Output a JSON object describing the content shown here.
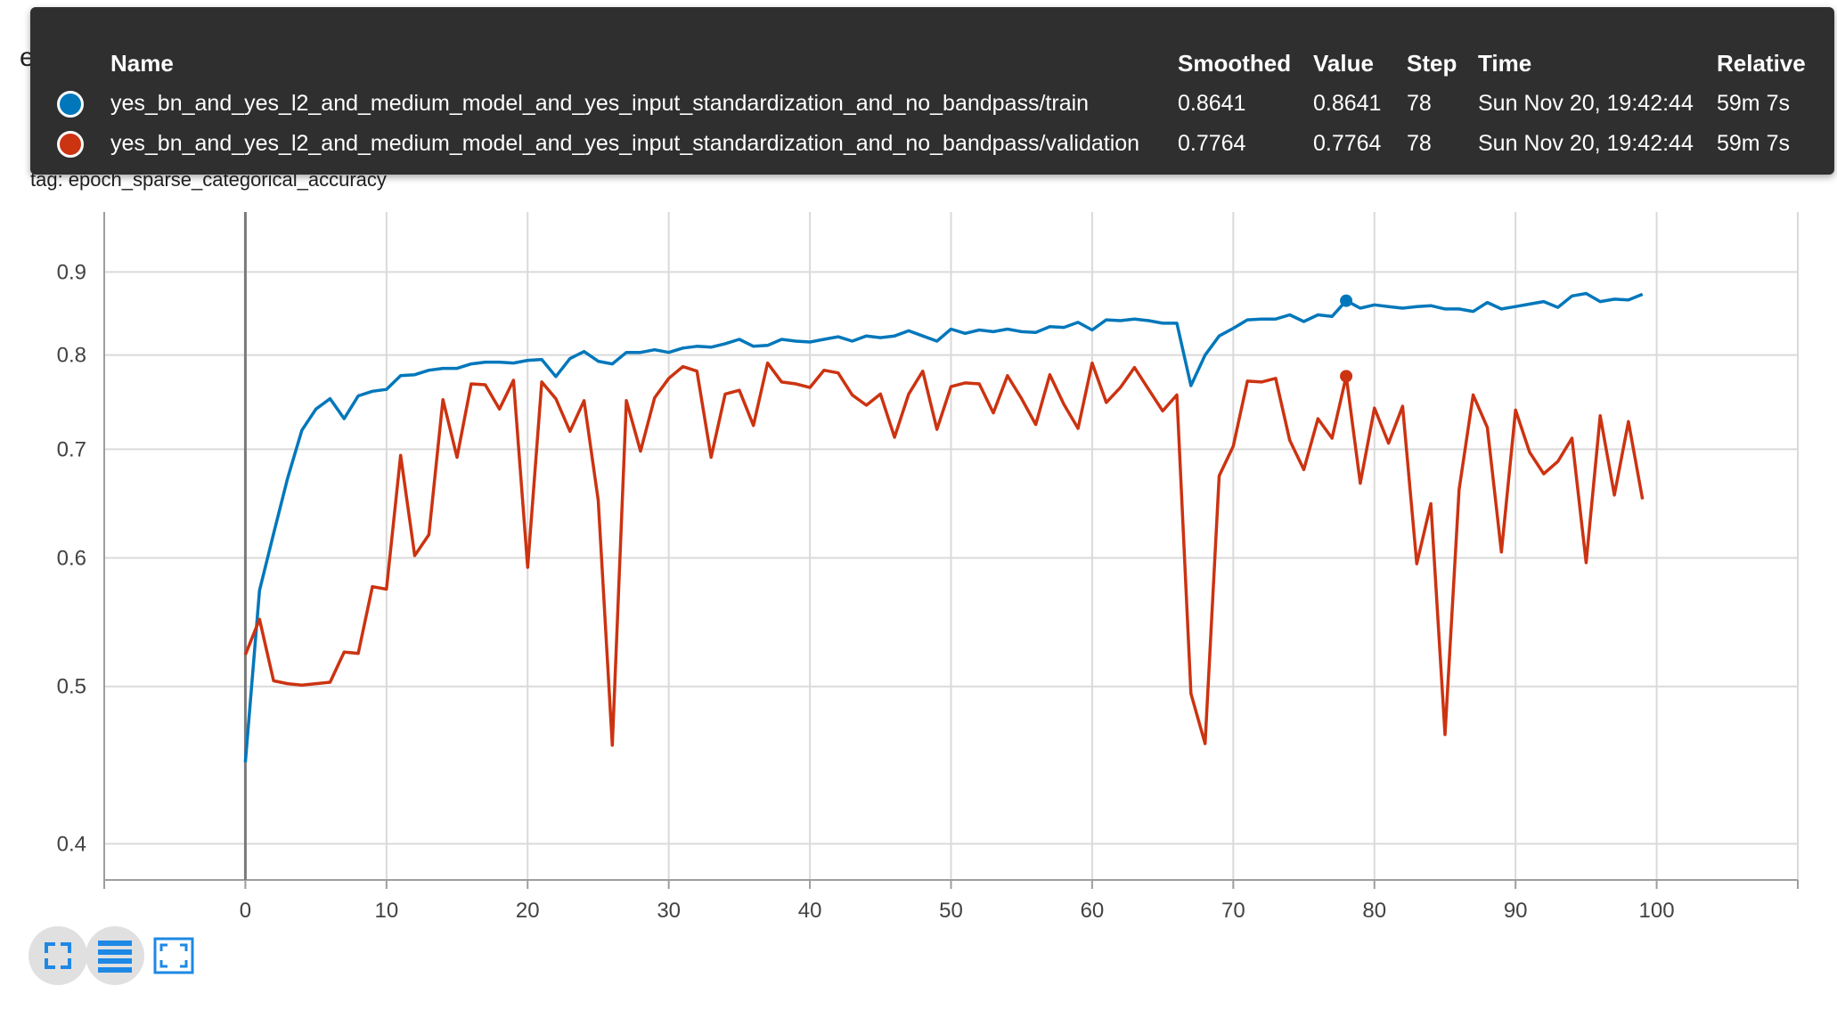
{
  "card": {
    "title": "epoch_sparse_categorical_accuracy",
    "subtitle": "epoch_sparse_categorical_accuracy",
    "tag": "tag: epoch_sparse_categorical_accuracy"
  },
  "tooltip": {
    "headers": {
      "name": "Name",
      "smoothed": "Smoothed",
      "value": "Value",
      "step": "Step",
      "time": "Time",
      "relative": "Relative"
    },
    "rows": [
      {
        "name": "yes_bn_and_yes_l2_and_medium_model_and_yes_input_standardization_and_no_bandpass/train",
        "smoothed": "0.8641",
        "value": "0.8641",
        "step": "78",
        "time": "Sun Nov 20, 19:42:44",
        "relative": "59m 7s",
        "color": "#0077bb"
      },
      {
        "name": "yes_bn_and_yes_l2_and_medium_model_and_yes_input_standardization_and_no_bandpass/validation",
        "smoothed": "0.7764",
        "value": "0.7764",
        "step": "78",
        "time": "Sun Nov 20, 19:42:44",
        "relative": "59m 7s",
        "color": "#cc3311"
      }
    ]
  },
  "toolbar": {
    "fullscreen_icon": "fullscreen-icon",
    "log_scale_icon": "log-scale-icon",
    "fit_domain_icon": "fit-domain-icon"
  },
  "chart_data": {
    "type": "line",
    "y_scale": "log",
    "xlim": [
      -10,
      110
    ],
    "ylim": [
      0.38,
      0.98
    ],
    "x_ticks": [
      0,
      10,
      20,
      30,
      40,
      50,
      60,
      70,
      80,
      90,
      100
    ],
    "y_ticks": [
      0.4,
      0.5,
      0.6,
      0.7,
      0.8,
      0.9
    ],
    "y_tick_labels": [
      "0.4",
      "0.5",
      "0.6",
      "0.7",
      "0.8",
      "0.9"
    ],
    "grid": true,
    "highlight_step": 78,
    "series": [
      {
        "color": "#0077bb",
        "x": [
          0,
          1,
          2,
          3,
          4,
          5,
          6,
          7,
          8,
          9,
          10,
          11,
          12,
          13,
          14,
          15,
          16,
          17,
          18,
          19,
          20,
          21,
          22,
          23,
          24,
          25,
          26,
          27,
          28,
          29,
          30,
          31,
          32,
          33,
          34,
          35,
          36,
          37,
          38,
          39,
          40,
          41,
          42,
          43,
          44,
          45,
          46,
          47,
          48,
          49,
          50,
          51,
          52,
          53,
          54,
          55,
          56,
          57,
          58,
          59,
          60,
          61,
          62,
          63,
          64,
          65,
          66,
          67,
          68,
          69,
          70,
          71,
          72,
          73,
          74,
          75,
          76,
          77,
          78,
          79,
          80,
          81,
          82,
          83,
          84,
          85,
          86,
          87,
          88,
          89,
          90,
          91,
          92,
          93,
          94,
          95,
          96,
          97,
          98,
          99
        ],
        "y": [
          0.449,
          0.573,
          0.621,
          0.672,
          0.719,
          0.741,
          0.752,
          0.731,
          0.755,
          0.76,
          0.762,
          0.777,
          0.778,
          0.783,
          0.785,
          0.785,
          0.79,
          0.792,
          0.792,
          0.791,
          0.794,
          0.795,
          0.776,
          0.796,
          0.804,
          0.793,
          0.79,
          0.803,
          0.803,
          0.806,
          0.803,
          0.808,
          0.81,
          0.809,
          0.813,
          0.818,
          0.81,
          0.811,
          0.818,
          0.816,
          0.815,
          0.818,
          0.821,
          0.816,
          0.822,
          0.82,
          0.822,
          0.828,
          0.822,
          0.816,
          0.83,
          0.825,
          0.829,
          0.827,
          0.83,
          0.827,
          0.826,
          0.833,
          0.832,
          0.838,
          0.829,
          0.841,
          0.84,
          0.842,
          0.84,
          0.837,
          0.837,
          0.766,
          0.8,
          0.822,
          0.831,
          0.841,
          0.842,
          0.842,
          0.847,
          0.839,
          0.847,
          0.845,
          0.8641,
          0.855,
          0.859,
          0.857,
          0.855,
          0.857,
          0.858,
          0.854,
          0.854,
          0.851,
          0.862,
          0.854,
          0.857,
          0.86,
          0.863,
          0.856,
          0.87,
          0.873,
          0.863,
          0.866,
          0.865,
          0.872
        ]
      },
      {
        "color": "#cc3311",
        "x": [
          0,
          1,
          2,
          3,
          4,
          5,
          6,
          7,
          8,
          9,
          10,
          11,
          12,
          13,
          14,
          15,
          16,
          17,
          18,
          19,
          20,
          21,
          22,
          23,
          24,
          25,
          26,
          27,
          28,
          29,
          30,
          31,
          32,
          33,
          34,
          35,
          36,
          37,
          38,
          39,
          40,
          41,
          42,
          43,
          44,
          45,
          46,
          47,
          48,
          49,
          50,
          51,
          52,
          53,
          54,
          55,
          56,
          57,
          58,
          59,
          60,
          61,
          62,
          63,
          64,
          65,
          66,
          67,
          68,
          69,
          70,
          71,
          72,
          73,
          74,
          75,
          76,
          77,
          78,
          79,
          80,
          81,
          82,
          83,
          84,
          85,
          86,
          87,
          88,
          89,
          90,
          91,
          92,
          93,
          94,
          95,
          96,
          97,
          98,
          99
        ],
        "y": [
          0.523,
          0.55,
          0.504,
          0.502,
          0.501,
          0.502,
          0.503,
          0.525,
          0.524,
          0.576,
          0.574,
          0.694,
          0.602,
          0.62,
          0.751,
          0.692,
          0.768,
          0.767,
          0.741,
          0.772,
          0.592,
          0.77,
          0.752,
          0.718,
          0.75,
          0.651,
          0.46,
          0.75,
          0.698,
          0.753,
          0.774,
          0.787,
          0.782,
          0.692,
          0.757,
          0.761,
          0.724,
          0.791,
          0.77,
          0.768,
          0.764,
          0.783,
          0.78,
          0.756,
          0.745,
          0.757,
          0.712,
          0.757,
          0.782,
          0.72,
          0.765,
          0.769,
          0.768,
          0.737,
          0.777,
          0.752,
          0.725,
          0.778,
          0.746,
          0.721,
          0.791,
          0.748,
          0.764,
          0.786,
          0.762,
          0.739,
          0.756,
          0.495,
          0.461,
          0.674,
          0.703,
          0.771,
          0.77,
          0.774,
          0.709,
          0.68,
          0.731,
          0.711,
          0.7764,
          0.667,
          0.742,
          0.706,
          0.744,
          0.595,
          0.648,
          0.467,
          0.661,
          0.756,
          0.722,
          0.605,
          0.74,
          0.697,
          0.676,
          0.688,
          0.711,
          0.596,
          0.734,
          0.656,
          0.728,
          0.652
        ]
      }
    ]
  }
}
